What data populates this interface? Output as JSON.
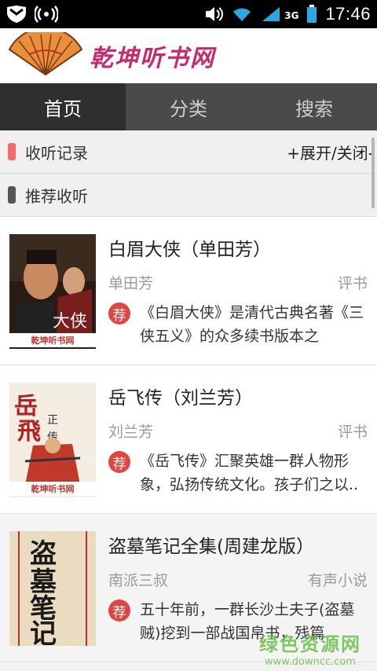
{
  "statusbar": {
    "time": "17:46",
    "network": "3G"
  },
  "header": {
    "logo_text": "乾坤听书网"
  },
  "tabs": [
    {
      "label": "首页",
      "active": true
    },
    {
      "label": "分类",
      "active": false
    },
    {
      "label": "搜索",
      "active": false
    }
  ],
  "history": {
    "title": "收听记录",
    "toggle": "+展开/关闭-",
    "mark_color": "#f26a6a"
  },
  "recommend": {
    "title": "推荐收听",
    "mark_color": "#555555"
  },
  "rec_badge": "荐",
  "items": [
    {
      "title": "白眉大侠（单田芳）",
      "author": "单田芳",
      "category": "评书",
      "desc": "《白眉大侠》是清代古典名著《三侠五义》的众多续书版本之",
      "cover_label": "乾坤听书网"
    },
    {
      "title": "岳飞传（刘兰芳）",
      "author": "刘兰芳",
      "category": "评书",
      "desc": "《岳飞传》汇聚英雄一群人物形象，弘扬传统文化。孩子们之以..",
      "cover_label": "乾坤听书网"
    },
    {
      "title": "盗墓笔记全集(周建龙版）",
      "author": "南派三叔",
      "category": "有声小说",
      "desc": "五十年前，一群长沙土夫子(盗墓贼)挖到一部战国帛书，残篇",
      "cover_label": ""
    }
  ],
  "watermark": {
    "main": "绿色资源网",
    "url": "www.downcc.com"
  }
}
